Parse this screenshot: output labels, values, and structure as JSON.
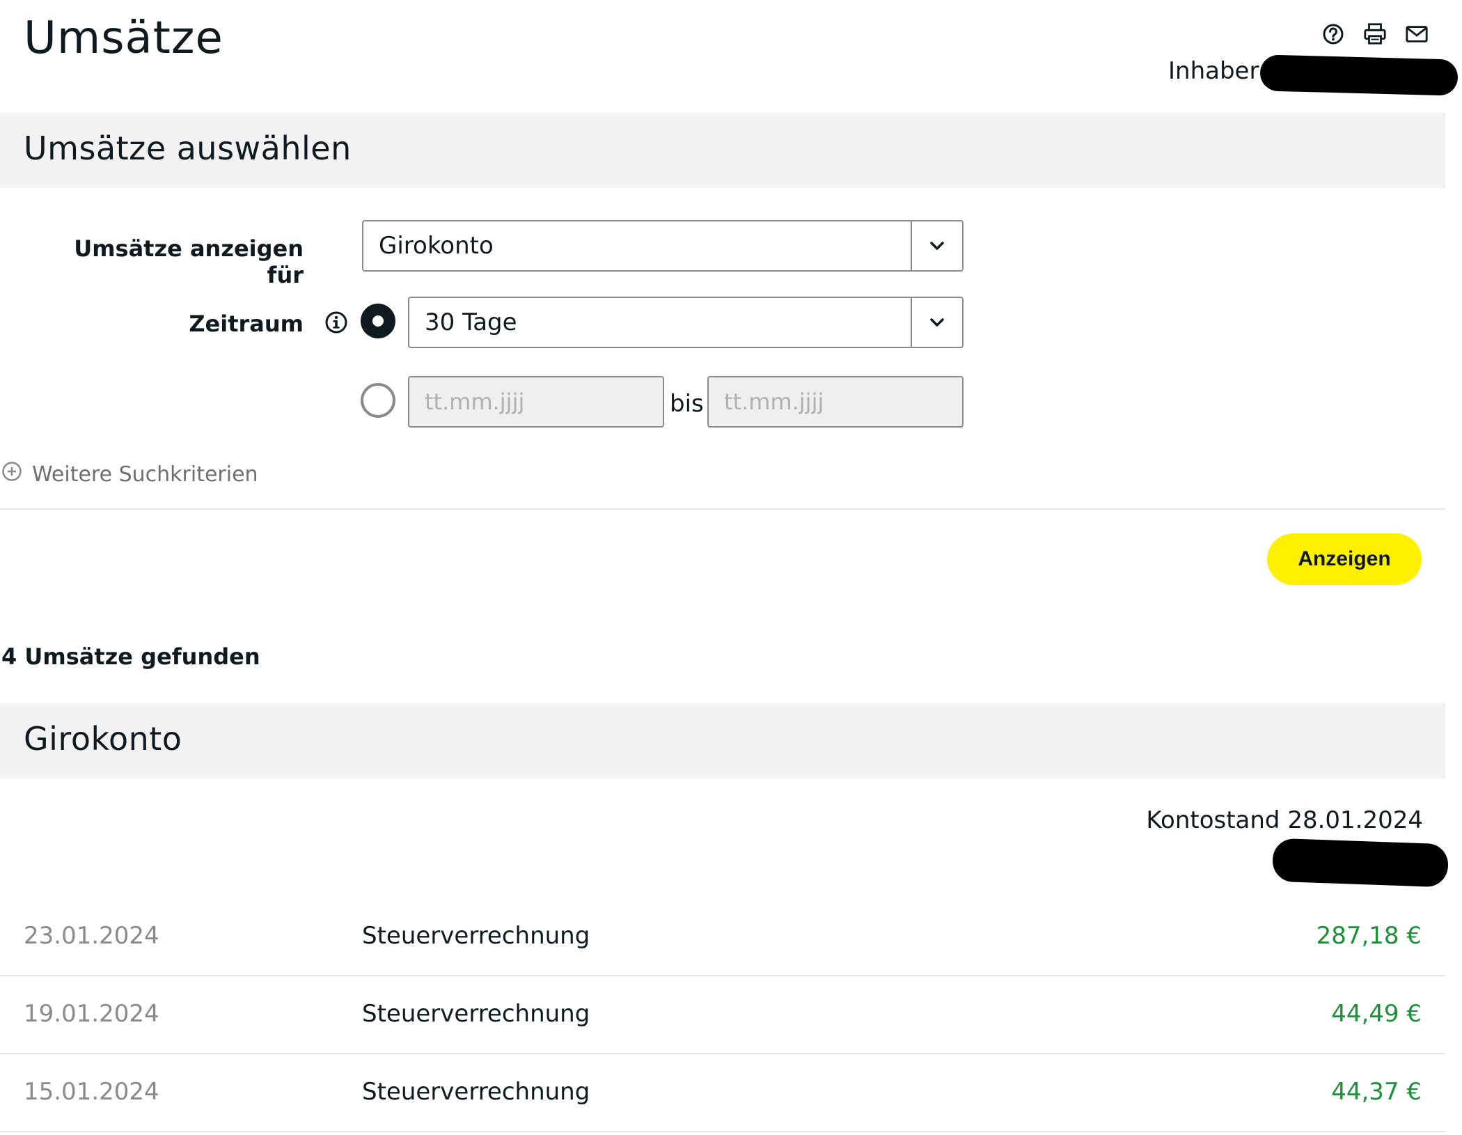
{
  "page": {
    "title": "Umsätze",
    "owner_label": "Inhaber:"
  },
  "toolbar": {
    "icons": [
      "help-icon",
      "print-icon",
      "mail-icon"
    ]
  },
  "selection_section": {
    "heading": "Umsätze auswählen",
    "account_label": "Umsätze anzeigen für",
    "account_value": "Girokonto",
    "period_label": "Zeitraum",
    "period_value": "30 Tage",
    "date_from_placeholder": "tt.mm.jjjj",
    "date_to_placeholder": "tt.mm.jjjj",
    "range_separator": "bis",
    "more_criteria": "Weitere Suchkriterien",
    "submit_label": "Anzeigen"
  },
  "results": {
    "count_text": "4 Umsätze gefunden",
    "account_heading": "Girokonto",
    "balance_label": "Kontostand 28.01.2024",
    "rows": [
      {
        "date": "23.01.2024",
        "description": "Steuerverrechnung",
        "amount": "287,18 €"
      },
      {
        "date": "19.01.2024",
        "description": "Steuerverrechnung",
        "amount": "44,49 €"
      },
      {
        "date": "15.01.2024",
        "description": "Steuerverrechnung",
        "amount": "44,37 €"
      }
    ]
  },
  "colors": {
    "accent_button": "#fff000",
    "positive_amount": "#1f8f3a",
    "section_band": "#f2f2f2",
    "text": "#0f1a20"
  }
}
